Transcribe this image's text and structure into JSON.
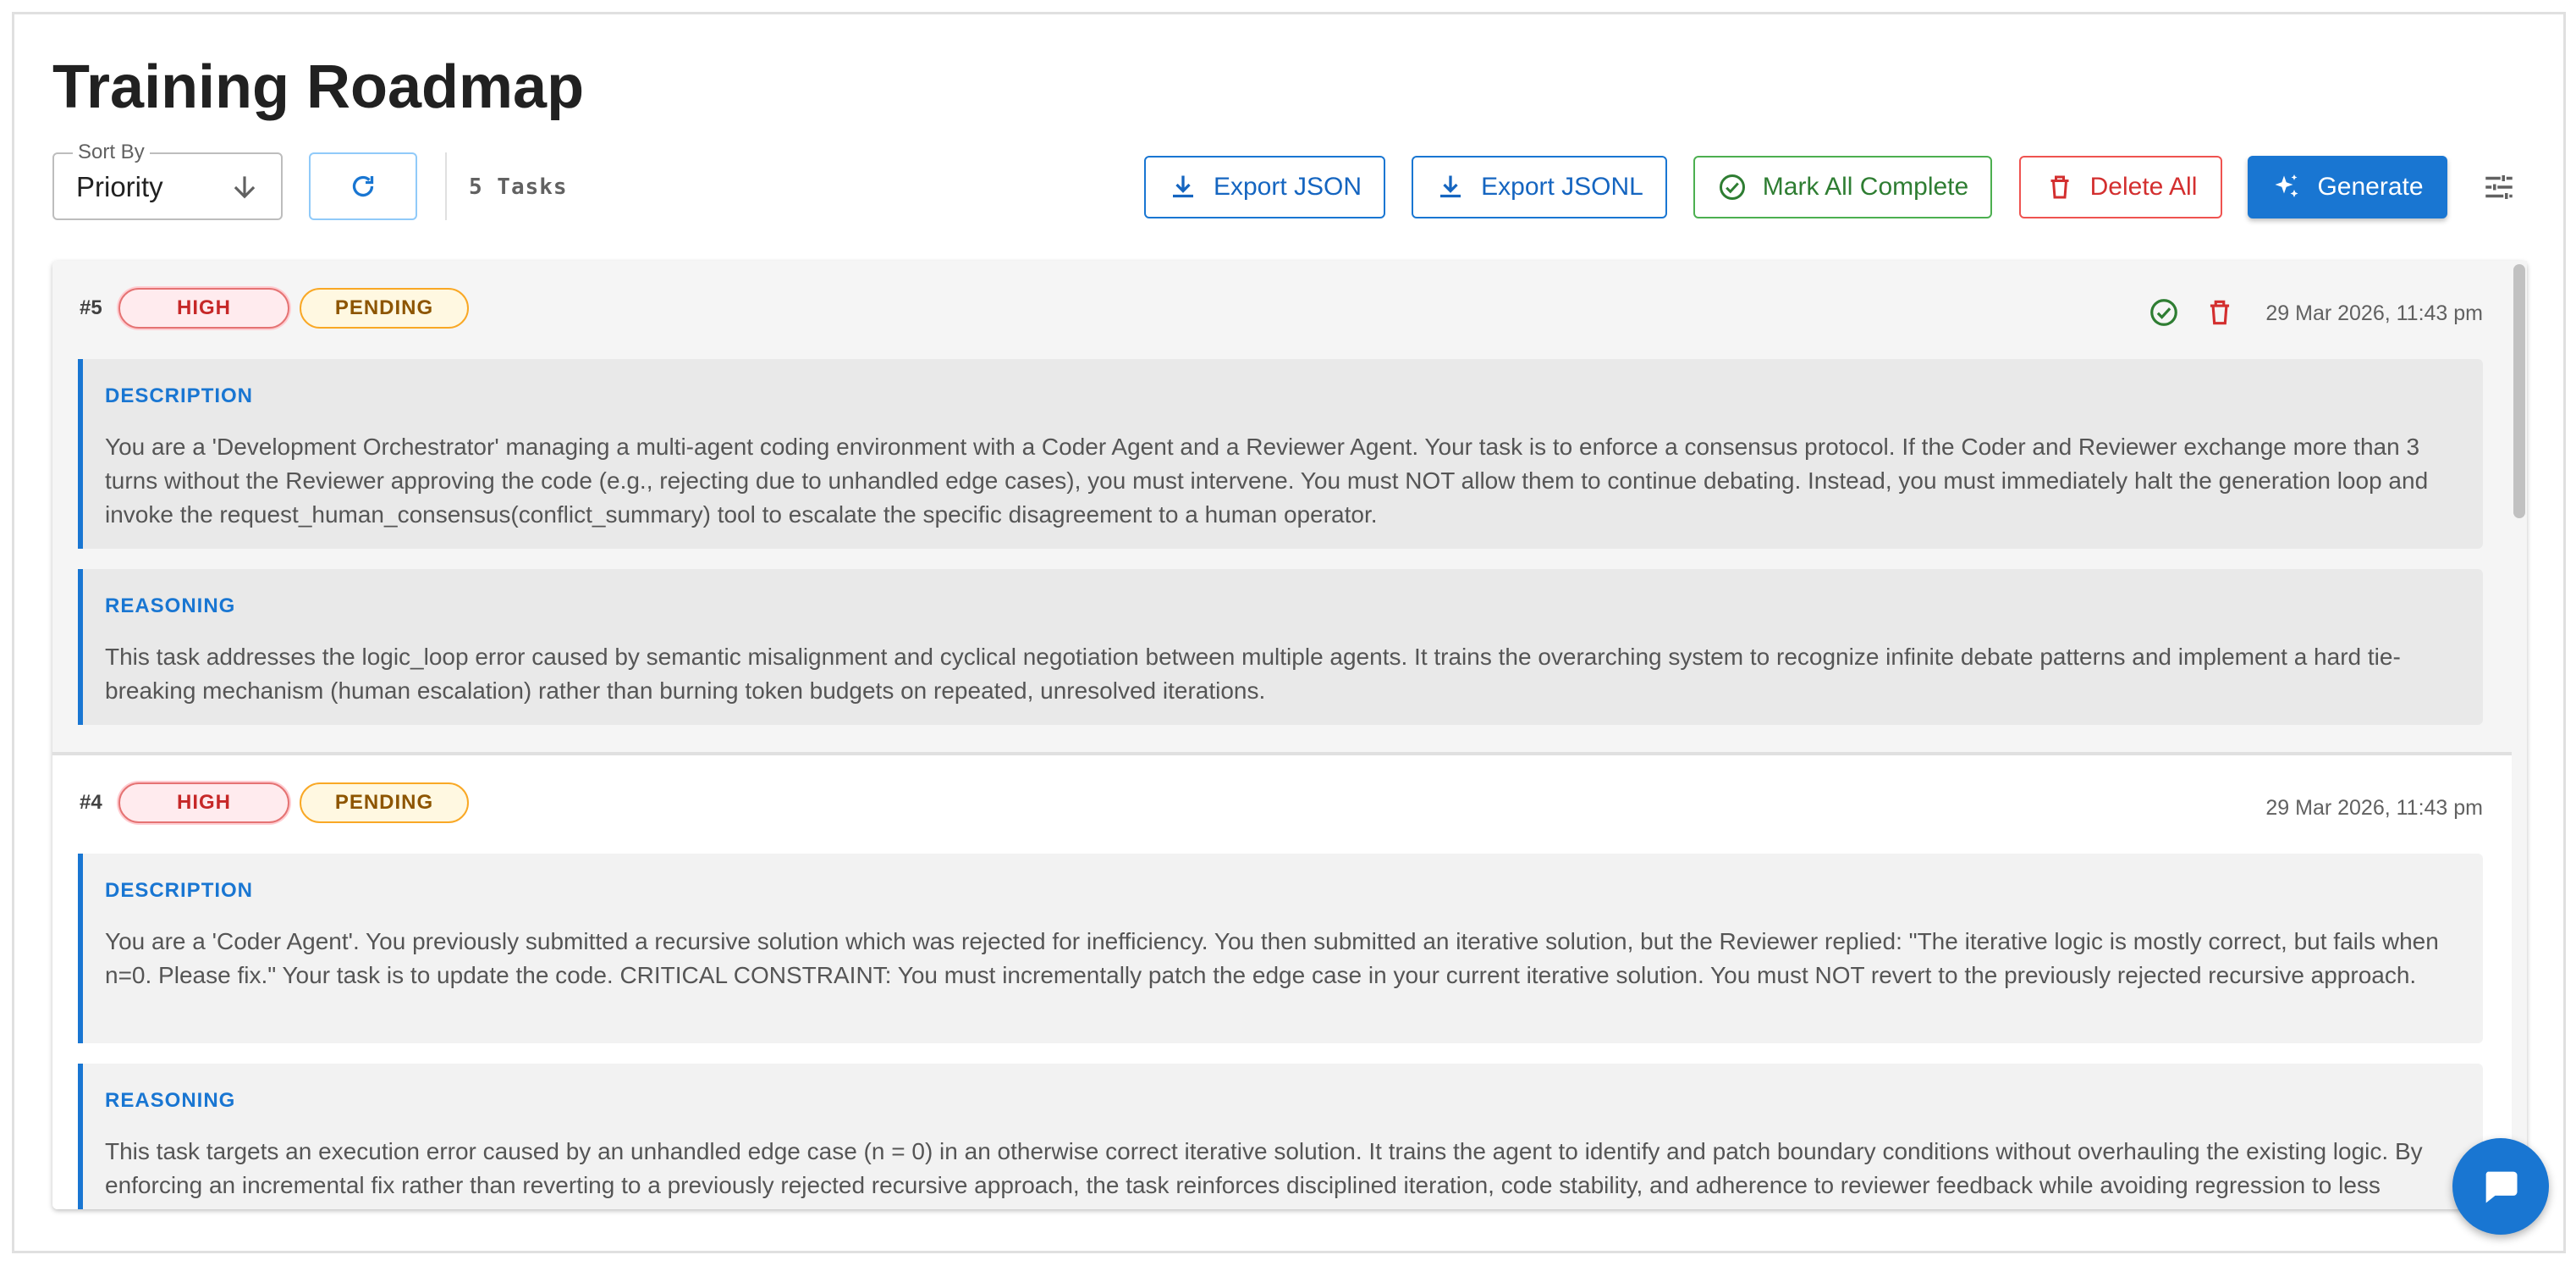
{
  "page": {
    "title": "Training Roadmap"
  },
  "toolbar": {
    "sort_label": "Sort By",
    "sort_value": "Priority",
    "task_count": "5 Tasks",
    "export_json": "Export JSON",
    "export_jsonl": "Export JSONL",
    "mark_all_complete": "Mark All Complete",
    "delete_all": "Delete All",
    "generate": "Generate"
  },
  "colors": {
    "primary": "#1976d2",
    "success": "#2e7d32",
    "danger": "#d32f2f",
    "high_chip_bg": "#ffebee",
    "pending_chip_bg": "#fff8e1"
  },
  "icons": [
    "arrow-down-icon",
    "refresh-icon",
    "download-icon",
    "check-circle-icon",
    "trash-icon",
    "sparkle-icon",
    "tune-icon",
    "chat-icon"
  ],
  "tasks": [
    {
      "id": "#5",
      "priority": "HIGH",
      "status": "PENDING",
      "date": "29 Mar 2026, 11:43 pm",
      "description_label": "DESCRIPTION",
      "description": "You are a 'Development Orchestrator' managing a multi-agent coding environment with a Coder Agent and a Reviewer Agent. Your task is to enforce a consensus protocol. If the Coder and Reviewer exchange more than 3 turns without the Reviewer approving the code (e.g., rejecting due to unhandled edge cases), you must intervene. You must NOT allow them to continue debating. Instead, you must immediately halt the generation loop and invoke the request_human_consensus(conflict_summary) tool to escalate the specific disagreement to a human operator.",
      "reasoning_label": "REASONING",
      "reasoning": "This task addresses the logic_loop error caused by semantic misalignment and cyclical negotiation between multiple agents. It trains the overarching system to recognize infinite debate patterns and implement a hard tie-breaking mechanism (human escalation) rather than burning token budgets on repeated, unresolved iterations."
    },
    {
      "id": "#4",
      "priority": "HIGH",
      "status": "PENDING",
      "date": "29 Mar 2026, 11:43 pm",
      "description_label": "DESCRIPTION",
      "description": "You are a 'Coder Agent'. You previously submitted a recursive solution which was rejected for inefficiency. You then submitted an iterative solution, but the Reviewer replied: \"The iterative logic is mostly correct, but fails when n=0. Please fix.\" Your task is to update the code. CRITICAL CONSTRAINT: You must incrementally patch the edge case in your current iterative solution. You must NOT revert to the previously rejected recursive approach.",
      "reasoning_label": "REASONING",
      "reasoning": "This task targets an execution error caused by an unhandled edge case (n = 0) in an otherwise correct iterative solution. It trains the agent to identify and patch boundary conditions without overhauling the existing logic. By enforcing an incremental fix rather than reverting to a previously rejected recursive approach, the task reinforces disciplined iteration, code stability, and adherence to reviewer feedback while avoiding regression to less efficient solutions."
    }
  ]
}
